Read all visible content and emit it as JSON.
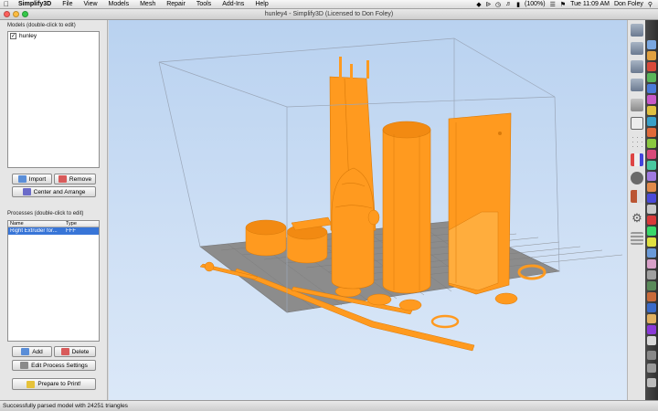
{
  "menubar": {
    "app_name": "Simplify3D",
    "items": [
      "File",
      "View",
      "Models",
      "Mesh",
      "Repair",
      "Tools",
      "Add-Ins",
      "Help"
    ],
    "battery": "(100%)",
    "clock": "Tue 11:09 AM",
    "user": "Don Foley"
  },
  "window": {
    "title": "hunley4 - Simplify3D (Licensed to Don Foley)"
  },
  "models": {
    "label": "Models (double-click to edit)",
    "items": [
      {
        "name": "hunley",
        "checked": true
      }
    ],
    "import_label": "Import",
    "remove_label": "Remove",
    "center_label": "Center and Arrange"
  },
  "processes": {
    "label": "Processes (double-click to edit)",
    "columns": [
      "Name",
      "Type"
    ],
    "rows": [
      {
        "name": "Right Extruder for...",
        "type": "FFF"
      }
    ],
    "add_label": "Add",
    "delete_label": "Delete",
    "edit_label": "Edit Process Settings",
    "prepare_label": "Prepare to Print!"
  },
  "status": {
    "message": "Successfully parsed model with 24251 triangles"
  },
  "colors": {
    "model": "#ff9a1f",
    "model_shade": "#d97a0a",
    "bed": "#8c8c8c",
    "bed_grid": "#7a7a7a",
    "selection": "#3875d7"
  },
  "toolbar_icons": [
    "view-iso-icon",
    "view-top-icon",
    "view-front-icon",
    "view-side-icon",
    "view-right-icon",
    "cube-outline-icon",
    "scatter-icon",
    "axis-icon",
    "tool-icon",
    "section-icon",
    "gear-icon",
    "layers-icon"
  ]
}
